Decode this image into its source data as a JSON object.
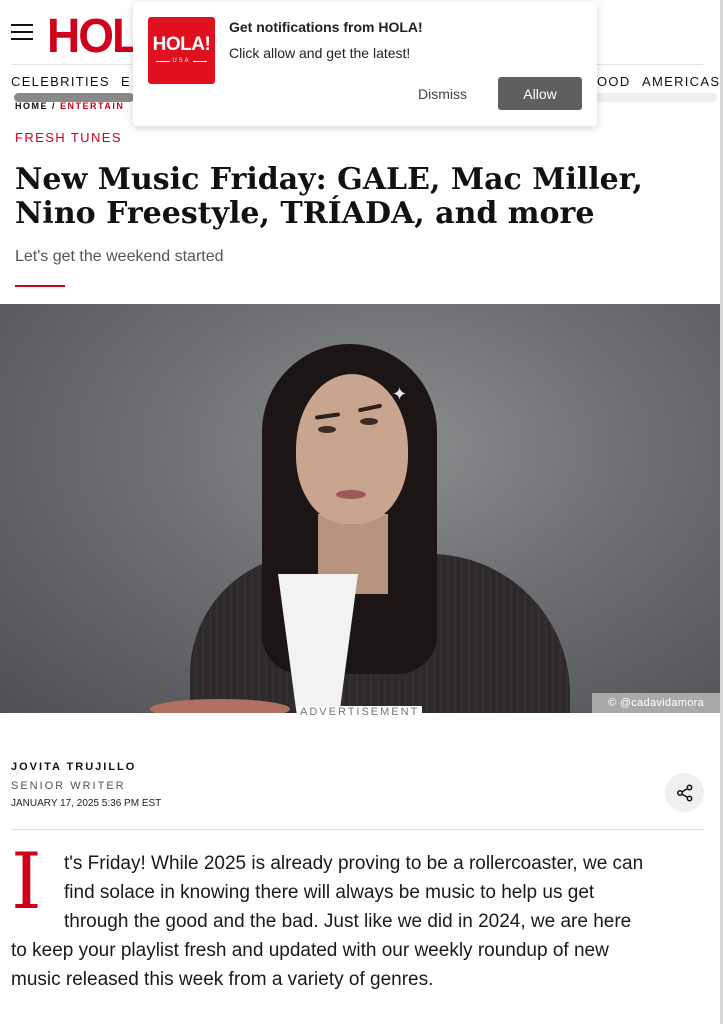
{
  "header": {
    "logo_text": "HOLA!",
    "nav": [
      "CELEBRITIES",
      "E",
      "OOD",
      "AMERICAS"
    ]
  },
  "breadcrumb": {
    "home": "HOME",
    "separator": "/",
    "current": "ENTERTAIN"
  },
  "article": {
    "category": "FRESH TUNES",
    "title": "New Music Friday: GALE, Mac Miller, Nino Freestyle, TRÍADA, and more",
    "subtitle": "Let's get the weekend started",
    "image_credit": "© @cadavidamora",
    "ad_label": "ADVERTISEMENT",
    "author": {
      "name": "JOVITA TRUJILLO",
      "role": "SENIOR WRITER",
      "date": "JANUARY 17, 2025 5:36 PM EST"
    },
    "drop_cap": "I",
    "body_lines": [
      "t's Friday! While 2025 is already proving to be a rollercoaster, we can",
      "find solace in knowing there will always be music to help us get",
      "through the good and the bad. Just like we did in 2024, we are here",
      "to keep your playlist fresh and updated with our weekly roundup of new",
      "music released this week from a variety of genres."
    ]
  },
  "notification": {
    "logo_text": "HOLA!",
    "logo_sub": "USA",
    "title": "Get notifications from HOLA!",
    "text": "Click allow and get the latest!",
    "dismiss_label": "Dismiss",
    "allow_label": "Allow"
  },
  "colors": {
    "brand": "#d0021b",
    "allow_button": "#5f5f5f"
  },
  "icons": {
    "menu": "hamburger-icon",
    "share": "share-icon"
  }
}
